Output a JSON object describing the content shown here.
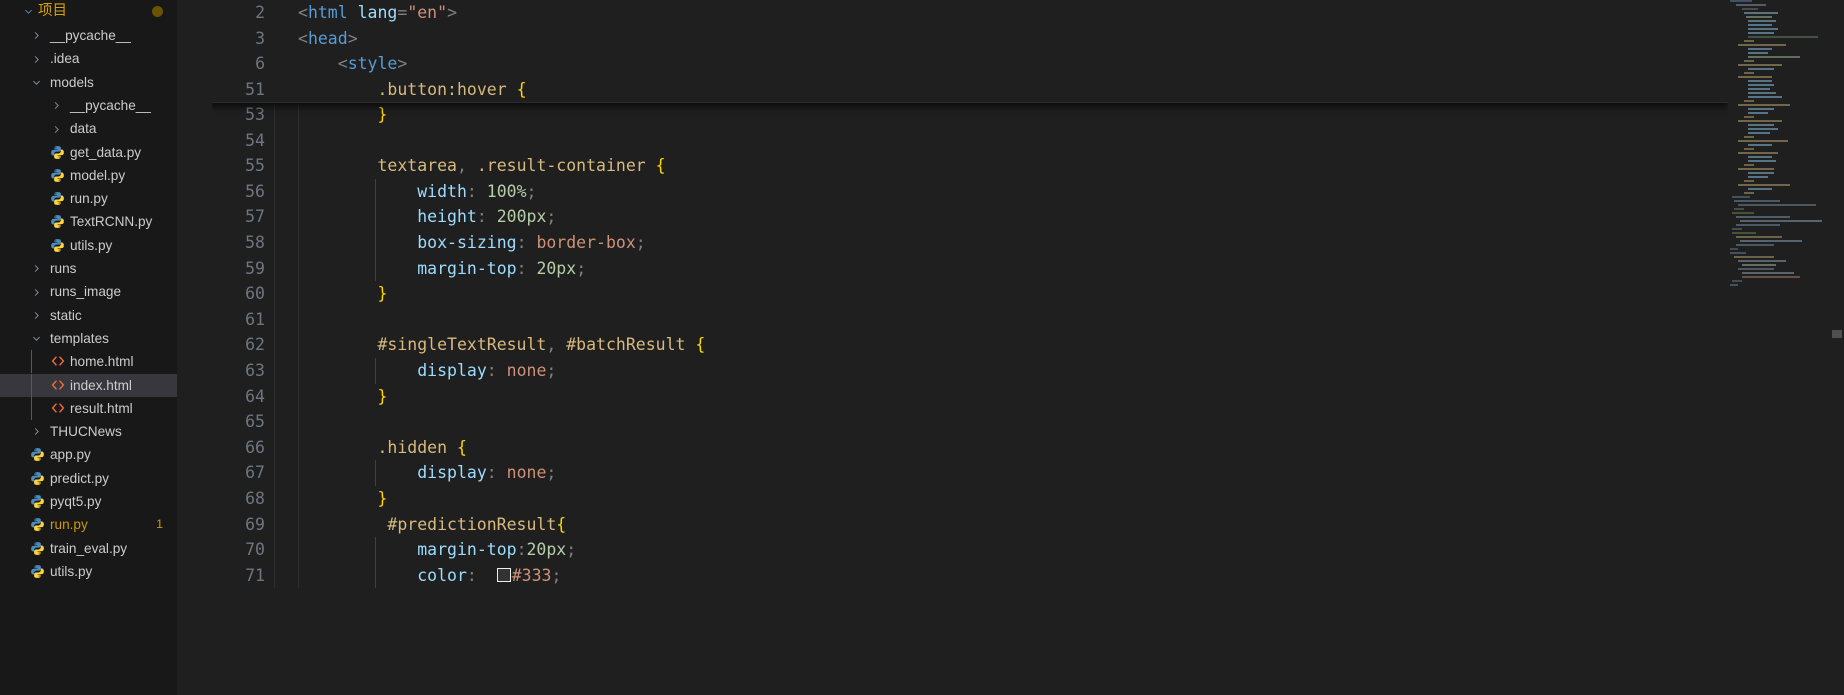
{
  "sidebar": {
    "root": {
      "label": "项目",
      "icon": "chevron-down-icon",
      "expanded": true,
      "dirty_dot": true
    },
    "items": [
      {
        "label": "__pycache__",
        "kind": "folder",
        "icon": "chevron-right-icon",
        "depth": 1,
        "expanded": false
      },
      {
        "label": ".idea",
        "kind": "folder",
        "icon": "chevron-right-icon",
        "depth": 1,
        "expanded": false
      },
      {
        "label": "models",
        "kind": "folder",
        "icon": "chevron-down-icon",
        "depth": 1,
        "expanded": true
      },
      {
        "label": "__pycache__",
        "kind": "folder",
        "icon": "chevron-right-icon",
        "depth": 2,
        "expanded": false
      },
      {
        "label": "data",
        "kind": "folder",
        "icon": "chevron-right-icon",
        "depth": 2,
        "expanded": false
      },
      {
        "label": "get_data.py",
        "kind": "python",
        "icon": "python-icon",
        "depth": 2
      },
      {
        "label": "model.py",
        "kind": "python",
        "icon": "python-icon",
        "depth": 2
      },
      {
        "label": "run.py",
        "kind": "python",
        "icon": "python-icon",
        "depth": 2
      },
      {
        "label": "TextRCNN.py",
        "kind": "python",
        "icon": "python-icon",
        "depth": 2
      },
      {
        "label": "utils.py",
        "kind": "python",
        "icon": "python-icon",
        "depth": 2
      },
      {
        "label": "runs",
        "kind": "folder",
        "icon": "chevron-right-icon",
        "depth": 1,
        "expanded": false
      },
      {
        "label": "runs_image",
        "kind": "folder",
        "icon": "chevron-right-icon",
        "depth": 1,
        "expanded": false
      },
      {
        "label": "static",
        "kind": "folder",
        "icon": "chevron-right-icon",
        "depth": 1,
        "expanded": false
      },
      {
        "label": "templates",
        "kind": "folder",
        "icon": "chevron-down-icon",
        "depth": 1,
        "expanded": true
      },
      {
        "label": "home.html",
        "kind": "html",
        "icon": "html-icon",
        "depth": 2
      },
      {
        "label": "index.html",
        "kind": "html",
        "icon": "html-icon",
        "depth": 2,
        "selected": true
      },
      {
        "label": "result.html",
        "kind": "html",
        "icon": "html-icon",
        "depth": 2
      },
      {
        "label": "THUCNews",
        "kind": "folder",
        "icon": "chevron-right-icon",
        "depth": 1,
        "expanded": false
      },
      {
        "label": "app.py",
        "kind": "python",
        "icon": "python-icon",
        "depth": 1
      },
      {
        "label": "predict.py",
        "kind": "python",
        "icon": "python-icon",
        "depth": 1
      },
      {
        "label": "pyqt5.py",
        "kind": "python",
        "icon": "python-icon",
        "depth": 1
      },
      {
        "label": "run.py",
        "kind": "python",
        "icon": "python-icon",
        "depth": 1,
        "badge": "1",
        "warning": true
      },
      {
        "label": "train_eval.py",
        "kind": "python",
        "icon": "python-icon",
        "depth": 1
      },
      {
        "label": "utils.py",
        "kind": "python",
        "icon": "python-icon",
        "depth": 1
      }
    ]
  },
  "editor": {
    "sticky_lines": [
      {
        "number": "2",
        "indent": 0,
        "text": "<html lang=\"en\">"
      },
      {
        "number": "3",
        "indent": 0,
        "text": "<head>"
      },
      {
        "number": "6",
        "indent": 1,
        "text": "<style>"
      },
      {
        "number": "51",
        "indent": 2,
        "text": ".button:hover {"
      }
    ],
    "lines": [
      {
        "number": "53",
        "indent": 2,
        "text": "}"
      },
      {
        "number": "54",
        "indent": 0,
        "text": ""
      },
      {
        "number": "55",
        "indent": 2,
        "text": "textarea, .result-container {"
      },
      {
        "number": "56",
        "indent": 3,
        "text": "width: 100%;"
      },
      {
        "number": "57",
        "indent": 3,
        "text": "height: 200px;"
      },
      {
        "number": "58",
        "indent": 3,
        "text": "box-sizing: border-box;"
      },
      {
        "number": "59",
        "indent": 3,
        "text": "margin-top: 20px;"
      },
      {
        "number": "60",
        "indent": 2,
        "text": "}"
      },
      {
        "number": "61",
        "indent": 0,
        "text": ""
      },
      {
        "number": "62",
        "indent": 2,
        "text": "#singleTextResult, #batchResult {"
      },
      {
        "number": "63",
        "indent": 3,
        "text": "display: none;"
      },
      {
        "number": "64",
        "indent": 2,
        "text": "}"
      },
      {
        "number": "65",
        "indent": 0,
        "text": ""
      },
      {
        "number": "66",
        "indent": 2,
        "text": ".hidden {"
      },
      {
        "number": "67",
        "indent": 3,
        "text": "display: none;"
      },
      {
        "number": "68",
        "indent": 2,
        "text": "}"
      },
      {
        "number": "69",
        "indent": 2,
        "text": " #predictionResult{"
      },
      {
        "number": "70",
        "indent": 3,
        "text": "margin-top:20px;"
      },
      {
        "number": "71",
        "indent": 3,
        "text": "color:  #333;"
      }
    ],
    "color_swatch": "#333333"
  },
  "colors": {
    "sidebar_bg": "#181818",
    "editor_bg": "#1f1f1f",
    "selection_bg": "#37373d",
    "accent_project": "#d8a200",
    "warning": "#cc9a00",
    "linenumber": "#6e7681",
    "html_icon": "#e8683c",
    "python_icon": "#3d85c6"
  },
  "minimap": {
    "present": true
  },
  "overview_ruler": {
    "present": true
  }
}
